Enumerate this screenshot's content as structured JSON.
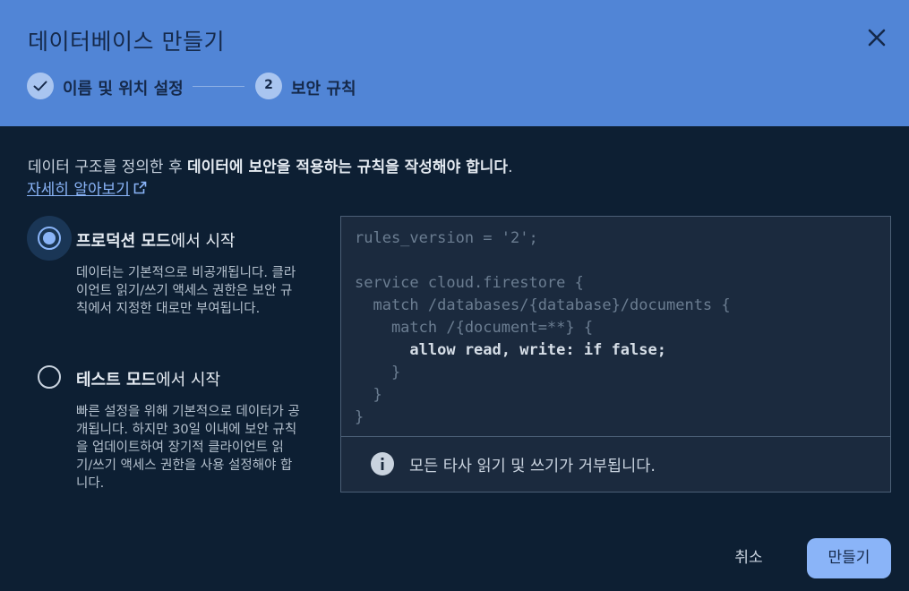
{
  "dialog": {
    "title": "데이터베이스 만들기",
    "close_icon": "close-icon"
  },
  "stepper": {
    "steps": [
      {
        "label": "이름 및 위치 설정",
        "state": "completed",
        "icon": "check-icon"
      },
      {
        "number": "2",
        "label": "보안 규칙",
        "state": "active"
      }
    ]
  },
  "intro": {
    "prefix": "데이터 구조를 정의한 후 ",
    "emphasis": "데이터에 보안을 적용하는 규칙을 작성해야 합니다",
    "suffix": ".",
    "learn_more": "자세히 알아보기",
    "learn_more_icon": "external-link-icon"
  },
  "options": [
    {
      "label_bold": "프로덕션 모드",
      "label_rest": "에서 시작",
      "selected": true,
      "description": "데이터는 기본적으로 비공개됩니다. 클라이언트 읽기/쓰기 액세스 권한은 보안 규칙에서 지정한 대로만 부여됩니다."
    },
    {
      "label_bold": "테스트 모드",
      "label_rest": "에서 시작",
      "selected": false,
      "description": "빠른 설정을 위해 기본적으로 데이터가 공개됩니다. 하지만 30일 이내에 보안 규칙을 업데이트하여 장기적 클라이언트 읽기/쓰기 액세스 권한을 사용 설정해야 합니다."
    }
  ],
  "code": {
    "lines": [
      "rules_version = '2';",
      "",
      "service cloud.firestore {",
      "  match /databases/{database}/documents {",
      "    match /{document=**} {",
      "      allow read, write: if false;",
      "    }",
      "  }",
      "}"
    ],
    "highlight_line": "      allow read, write: if false;"
  },
  "info": {
    "icon": "info-icon",
    "text": "모든 타사 읽기 및 쓰기가 거부됩니다."
  },
  "footer": {
    "cancel_label": "취소",
    "create_label": "만들기"
  },
  "colors": {
    "header_bg": "#5185d6",
    "body_bg": "#0d1f33",
    "accent": "#8ab4f8",
    "code_bg": "#1b2a3e"
  }
}
